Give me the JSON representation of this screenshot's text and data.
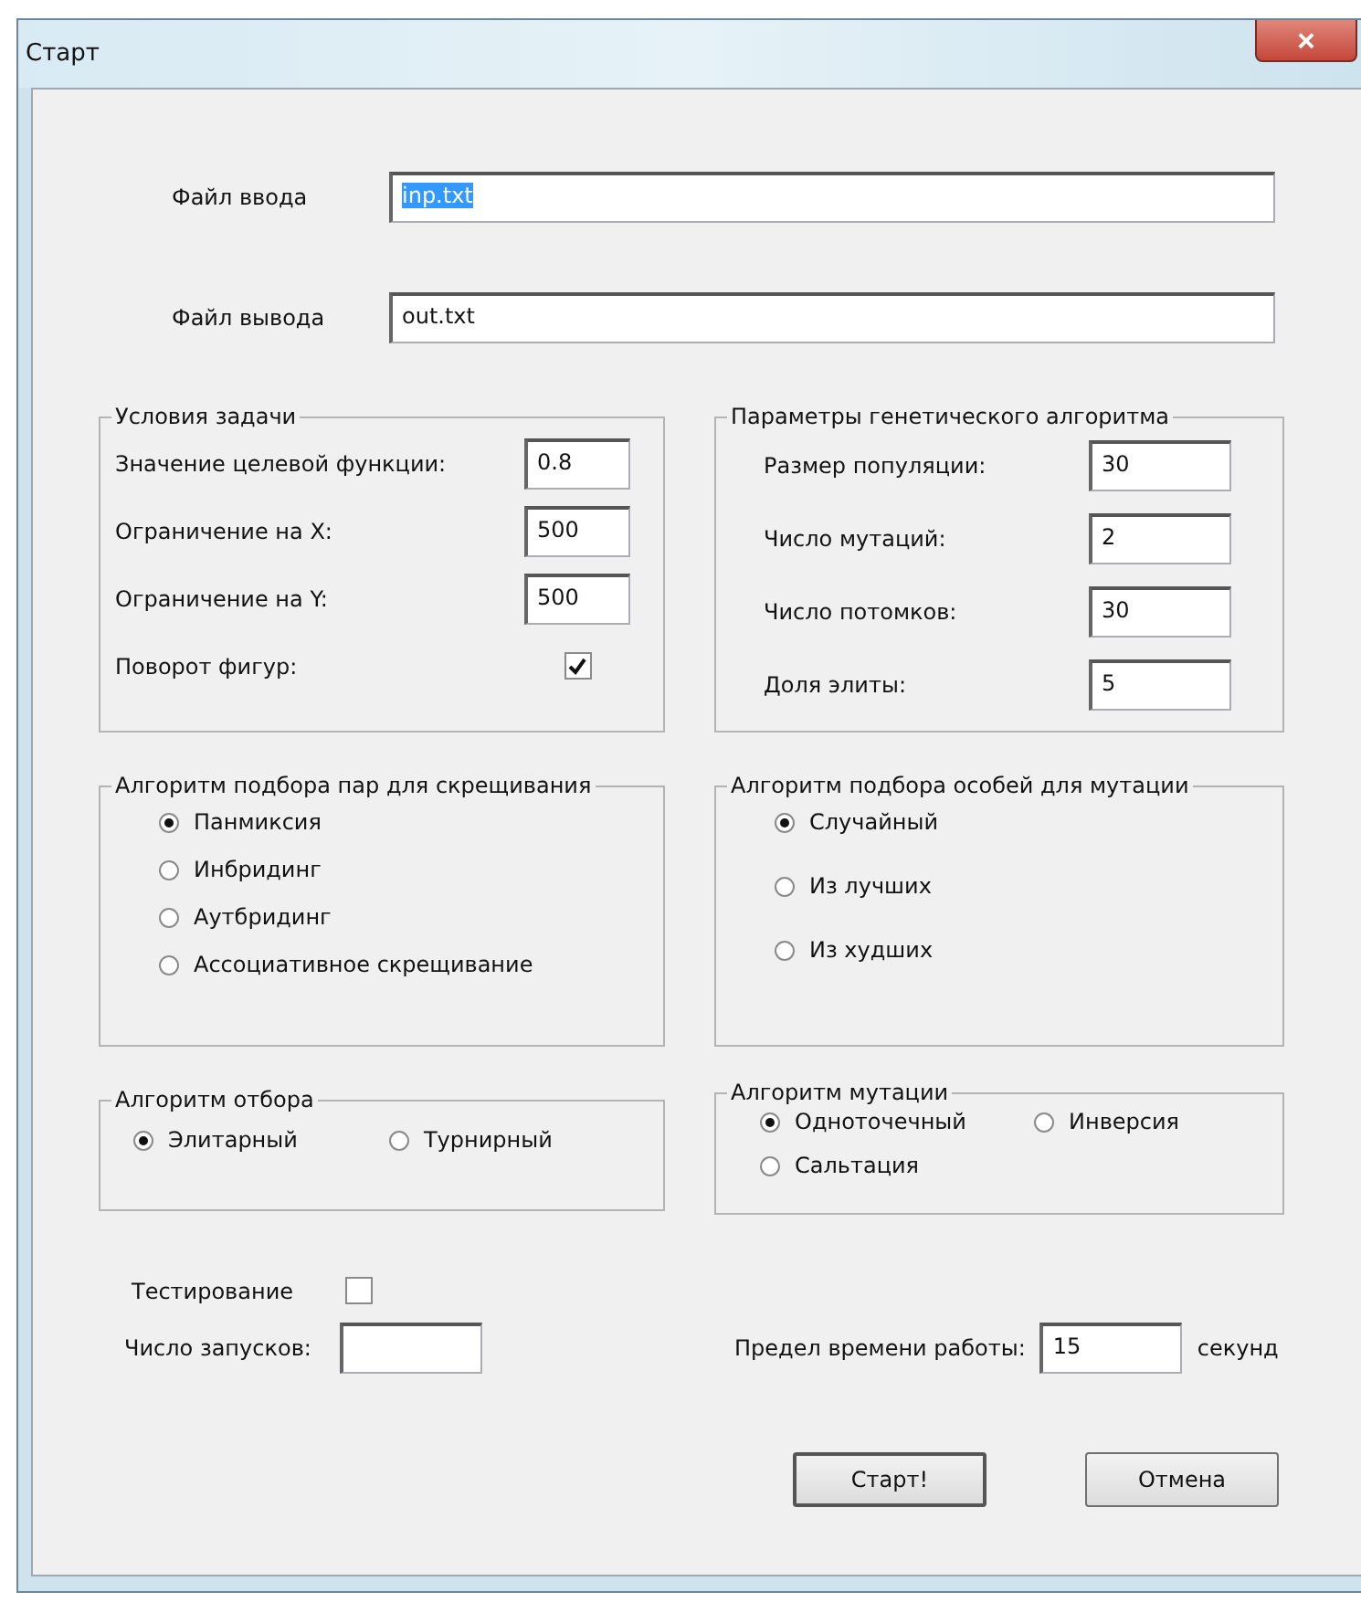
{
  "window": {
    "title": "Старт",
    "close_button": "×"
  },
  "files": [
    {
      "label": "Файл ввода",
      "value": "inp.txt",
      "text_selected": true
    },
    {
      "label": "Файл вывода",
      "value": "out.txt",
      "text_selected": false
    }
  ],
  "conditions": {
    "title": "Условия задачи",
    "fields": [
      {
        "label": "Значение целевой функции:",
        "value": "0.8"
      },
      {
        "label": "Ограничение на X:",
        "value": "500"
      },
      {
        "label": "Ограничение на Y:",
        "value": "500"
      }
    ],
    "rotation": {
      "label": "Поворот фигур:",
      "checked": true
    }
  },
  "ga_params": {
    "title": "Параметры генетического алгоритма",
    "fields": [
      {
        "label": "Размер популяции:",
        "value": "30"
      },
      {
        "label": "Число мутаций:",
        "value": "2"
      },
      {
        "label": "Число потомков:",
        "value": "30"
      },
      {
        "label": "Доля элиты:",
        "value": "5"
      }
    ]
  },
  "pairing": {
    "title": "Алгоритм подбора пар для скрещивания",
    "options": [
      {
        "label": "Панмиксия",
        "selected": true
      },
      {
        "label": "Инбридинг",
        "selected": false
      },
      {
        "label": "Аутбридинг",
        "selected": false
      },
      {
        "label": "Ассоциативное скрещивание",
        "selected": false
      }
    ]
  },
  "mutation_selection": {
    "title": "Алгоритм подбора особей для мутации",
    "options": [
      {
        "label": "Случайный",
        "selected": true
      },
      {
        "label": "Из лучших",
        "selected": false
      },
      {
        "label": "Из худших",
        "selected": false
      }
    ]
  },
  "selection": {
    "title": "Алгоритм отбора",
    "options": [
      {
        "label": "Элитарный",
        "selected": true
      },
      {
        "label": "Турнирный",
        "selected": false
      }
    ]
  },
  "mutation": {
    "title": "Алгоритм мутации",
    "options": [
      {
        "label": "Одноточечный",
        "selected": true
      },
      {
        "label": "Инверсия",
        "selected": false
      },
      {
        "label": "Сальтация",
        "selected": false
      }
    ]
  },
  "testing": {
    "label": "Тестирование",
    "checked": false
  },
  "runs": {
    "label": "Число запусков:"
  },
  "time_limit": {
    "label": "Предел времени работы:",
    "value": "15",
    "unit": "секунд"
  },
  "buttons": [
    {
      "label": "Старт!",
      "default": true
    },
    {
      "label": "Отмена",
      "default": false
    }
  ]
}
